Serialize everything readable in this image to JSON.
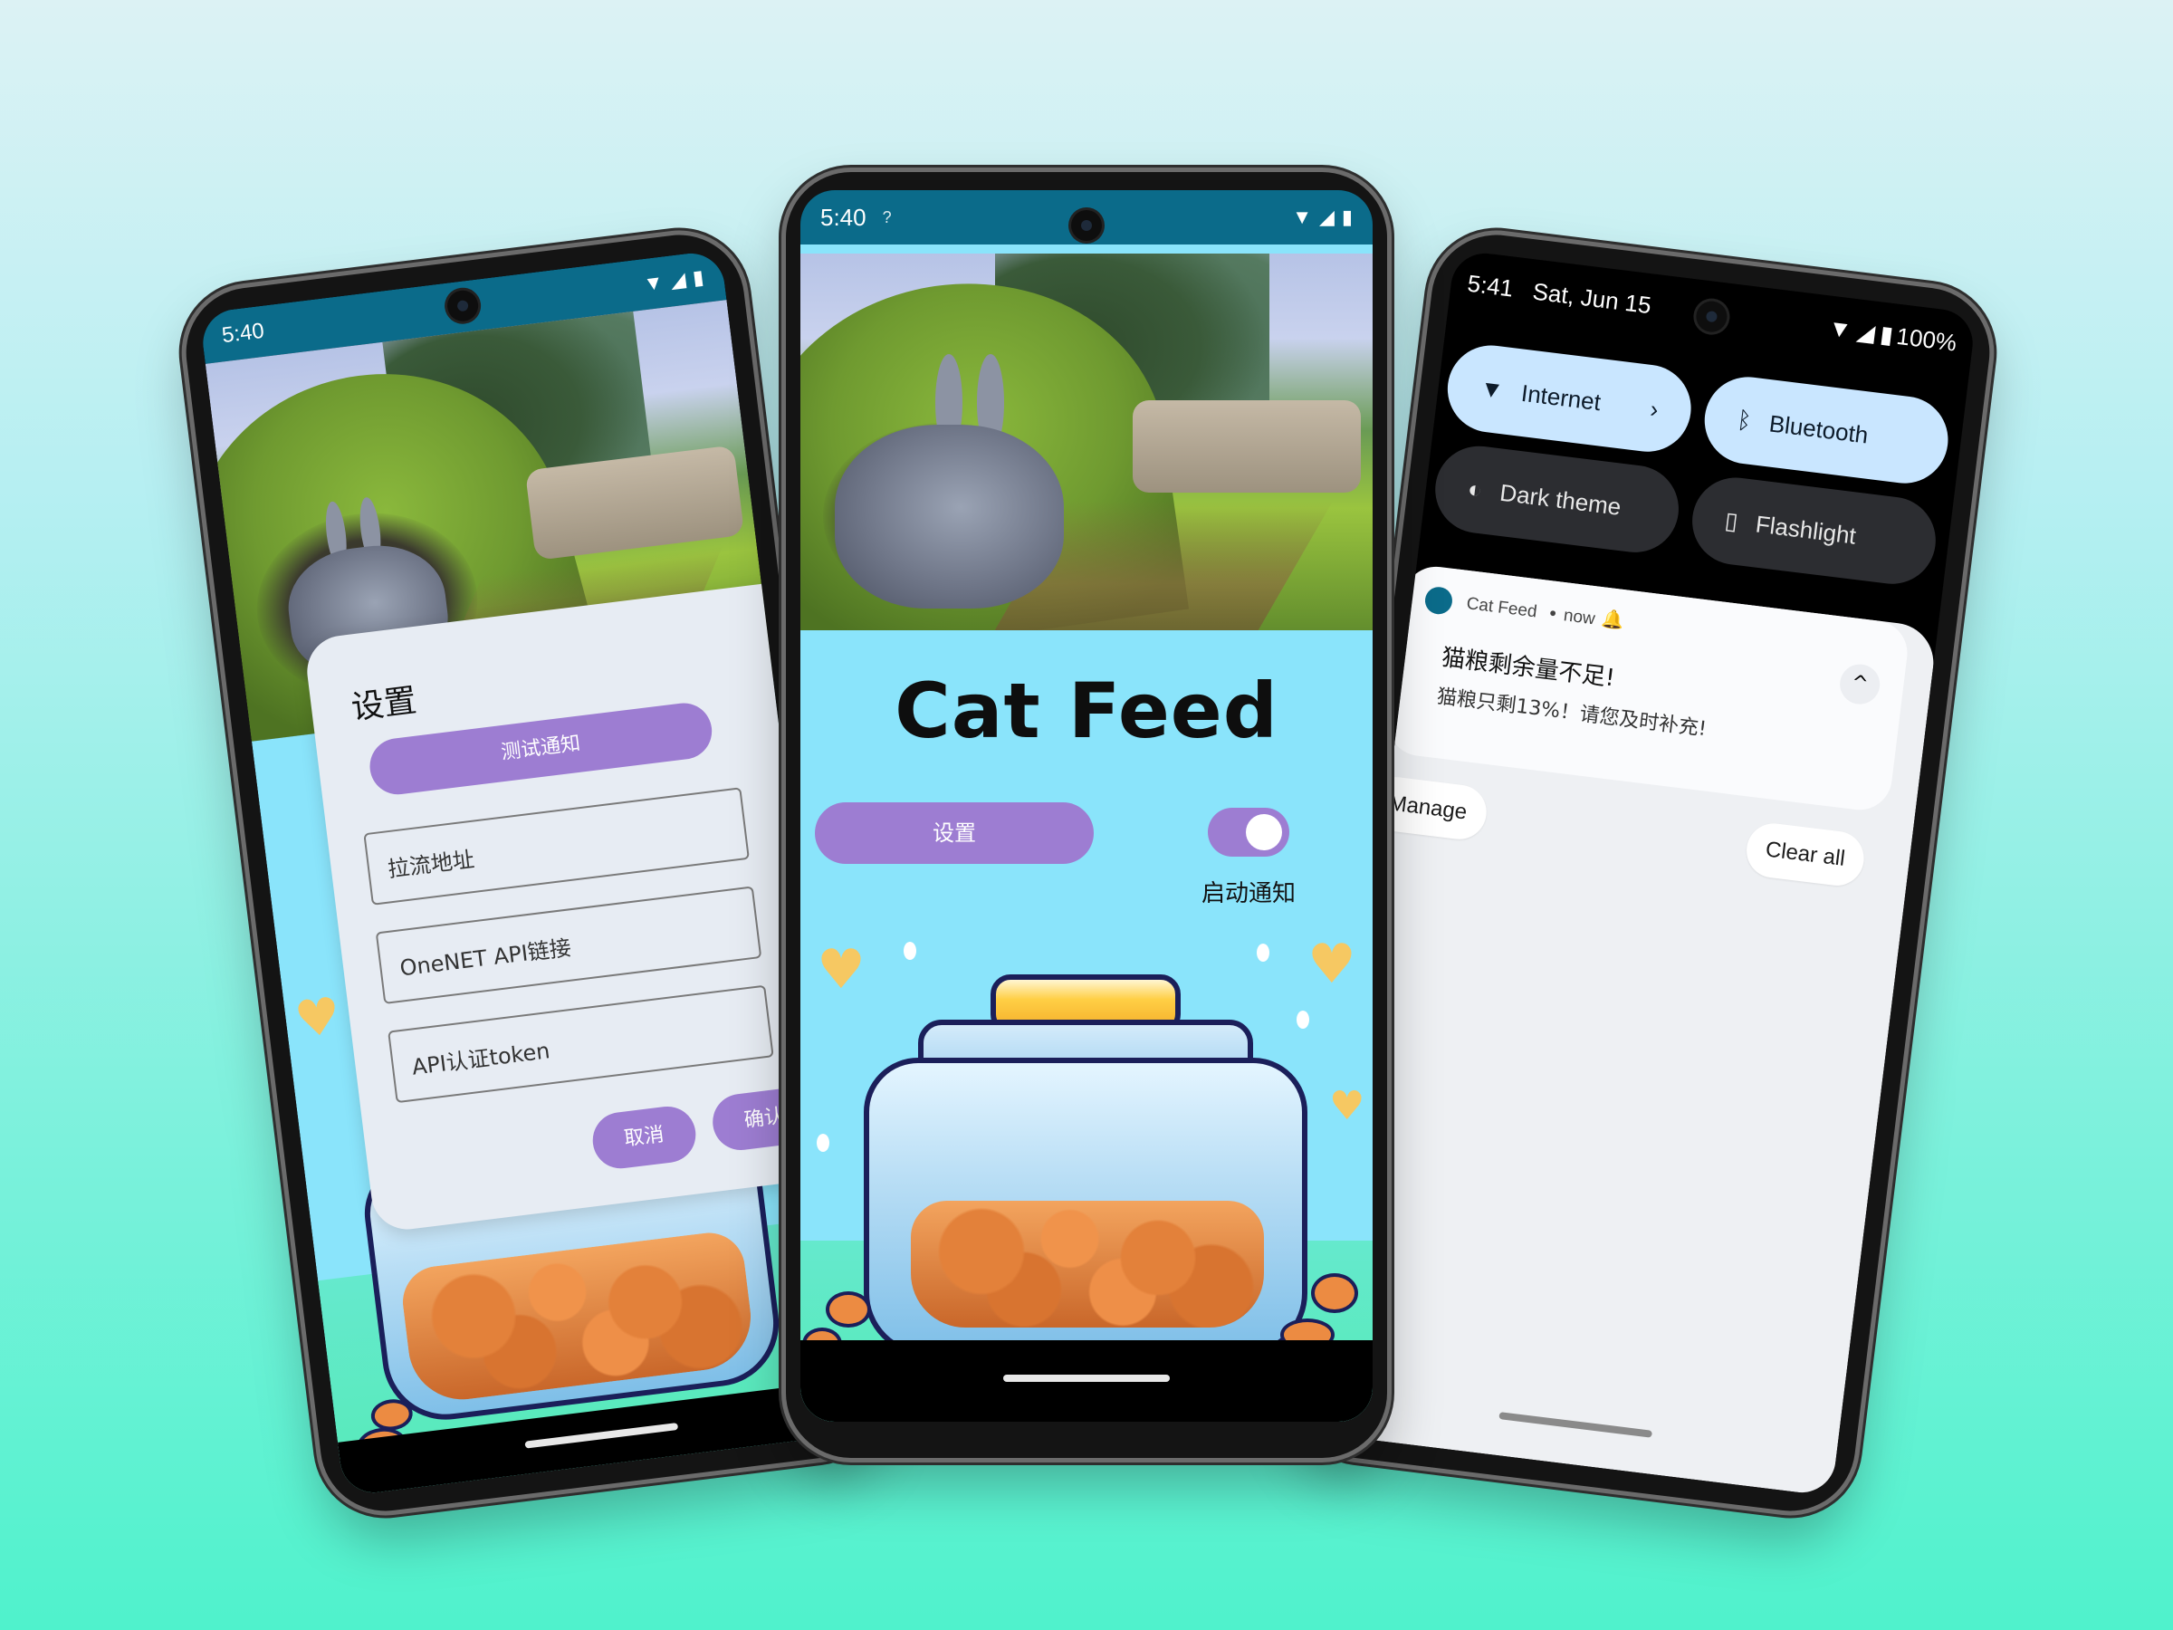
{
  "status_bar": {
    "time": "5:40",
    "wifi_question": "?",
    "icons": [
      "wifi-icon",
      "signal-icon",
      "battery-icon"
    ]
  },
  "app": {
    "title": "Cat Feed",
    "settings_button": "设置",
    "notify_toggle_label": "启动通知",
    "notify_enabled": true,
    "food_count": "4"
  },
  "settings_dialog": {
    "title": "设置",
    "test_notification_button": "测试通知",
    "fields": {
      "stream_url_placeholder": "拉流地址",
      "onenet_api_placeholder": "OneNET API链接",
      "api_token_placeholder": "API认证token"
    },
    "cancel_button": "取消",
    "confirm_button": "确认"
  },
  "quick_settings": {
    "time": "5:41",
    "date": "Sat, Jun 15",
    "battery": "100%",
    "tiles": [
      {
        "label": "Internet",
        "icon": "wifi-icon",
        "state": "on",
        "chevron": "›"
      },
      {
        "label": "Bluetooth",
        "icon": "bluetooth-icon",
        "state": "on"
      },
      {
        "label": "Dark theme",
        "icon": "contrast-icon",
        "state": "off"
      },
      {
        "label": "Flashlight",
        "icon": "flashlight-icon",
        "state": "off"
      }
    ],
    "notification": {
      "app_name": "Cat Feed",
      "time": "now",
      "title": "猫粮剩余量不足!",
      "text": "猫粮只剩13%！请您及时补充!"
    },
    "manage_button": "Manage",
    "clear_all_button": "Clear all"
  },
  "colors": {
    "accent_purple": "#9d7dd2",
    "app_background": "#8ae4fb",
    "status_bar": "#0b6b8a",
    "tile_on": "#c9e6ff",
    "tile_off": "#2c2d31"
  }
}
